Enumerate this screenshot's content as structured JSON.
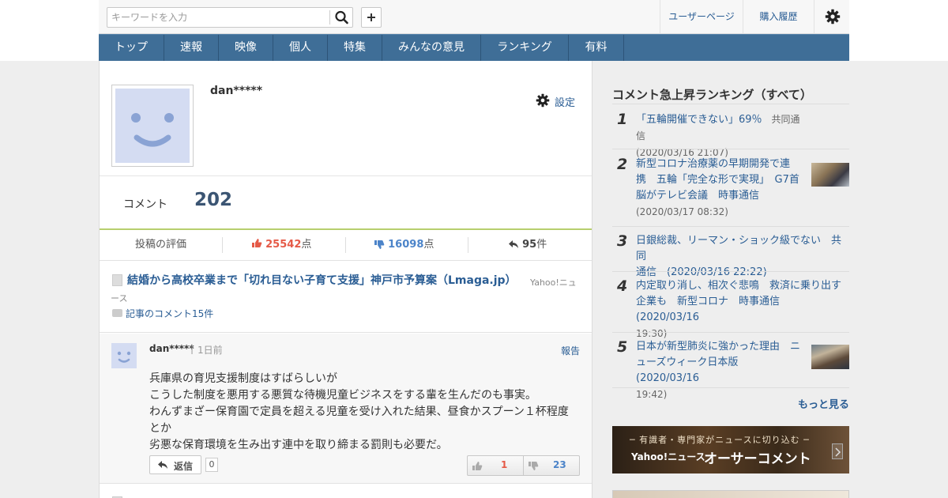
{
  "header": {
    "search_placeholder": "キーワードを入力",
    "user_page": "ユーザーページ",
    "purchase_history": "購入履歴"
  },
  "nav": [
    "トップ",
    "速報",
    "映像",
    "個人",
    "特集",
    "みんなの意見",
    "ランキング",
    "有料"
  ],
  "profile": {
    "username": "dan*****",
    "settings_label": "設定",
    "comment_label": "コメント",
    "comment_count": "202"
  },
  "stats": {
    "label": "投稿の評価",
    "likes": "25542",
    "likes_unit": "点",
    "dislikes": "16098",
    "dislikes_unit": "点",
    "replies": "95",
    "replies_unit": "件"
  },
  "article": {
    "title": "結婚から高校卒業まで「切れ目ない子育て支援」神戸市予算案（Lmaga.jp）",
    "source_part1": "Yahoo!ニュ",
    "source_part2": "ース",
    "comments_link": "記事のコメント15件"
  },
  "comment": {
    "user": "dan*****",
    "separator": "|",
    "time": "1日前",
    "report": "報告",
    "body": [
      "兵庫県の育児支援制度はすばらしいが",
      "こうした制度を悪用する悪質な待機児童ビジネスをする輩を生んだのも事実。",
      "わんずまざー保育園で定員を超える児童を受け入れた結果、昼食かスプーン１杯程度",
      "とか",
      "劣悪な保育環境を生み出す連中を取り締まる罰則も必要だ。"
    ],
    "reply_label": "返信",
    "reply_count": "0",
    "likes": "1",
    "dislikes": "23"
  },
  "ranking": {
    "title": "コメント急上昇ランキング（すべて）",
    "items": [
      {
        "rank": "1",
        "title": "「五輪開催できない」69％",
        "lines": [
          "「五輪開催できない」69％　共同通信",
          "(2020/03/16 21:07)"
        ]
      },
      {
        "rank": "2",
        "lines": [
          "新型コロナ治療薬の早期開発で連",
          "携　五輪「完全な形で実現」　G7首",
          "脳がテレビ会議　時事通信",
          "(2020/03/17 08:32)"
        ]
      },
      {
        "rank": "3",
        "lines": [
          "日銀総裁、リーマン・ショック級でない　共同",
          "通信　(2020/03/16 22:22)"
        ]
      },
      {
        "rank": "4",
        "lines": [
          "内定取り消し、相次ぐ悲鳴　救済に乗り出す",
          "企業も　新型コロナ　時事通信　(2020/03/16",
          "19:30)"
        ]
      },
      {
        "rank": "5",
        "lines": [
          "日本が新型肺炎に強かった理由　ニ",
          "ューズウィーク日本版　(2020/03/16",
          "19:42)"
        ]
      }
    ],
    "more": "もっと見る"
  },
  "banner": {
    "line1": "─ 有識者・専門家がニュースに切り込む ─",
    "brand": "Yahoo!ニュース",
    "product": "オーサーコメント"
  },
  "colors": {
    "nav_bg": "#3f6e97",
    "link": "#2a5d94",
    "like_red": "#e55a47",
    "dislike_blue": "#4c84c9",
    "accent_green": "#b7cf6e"
  }
}
